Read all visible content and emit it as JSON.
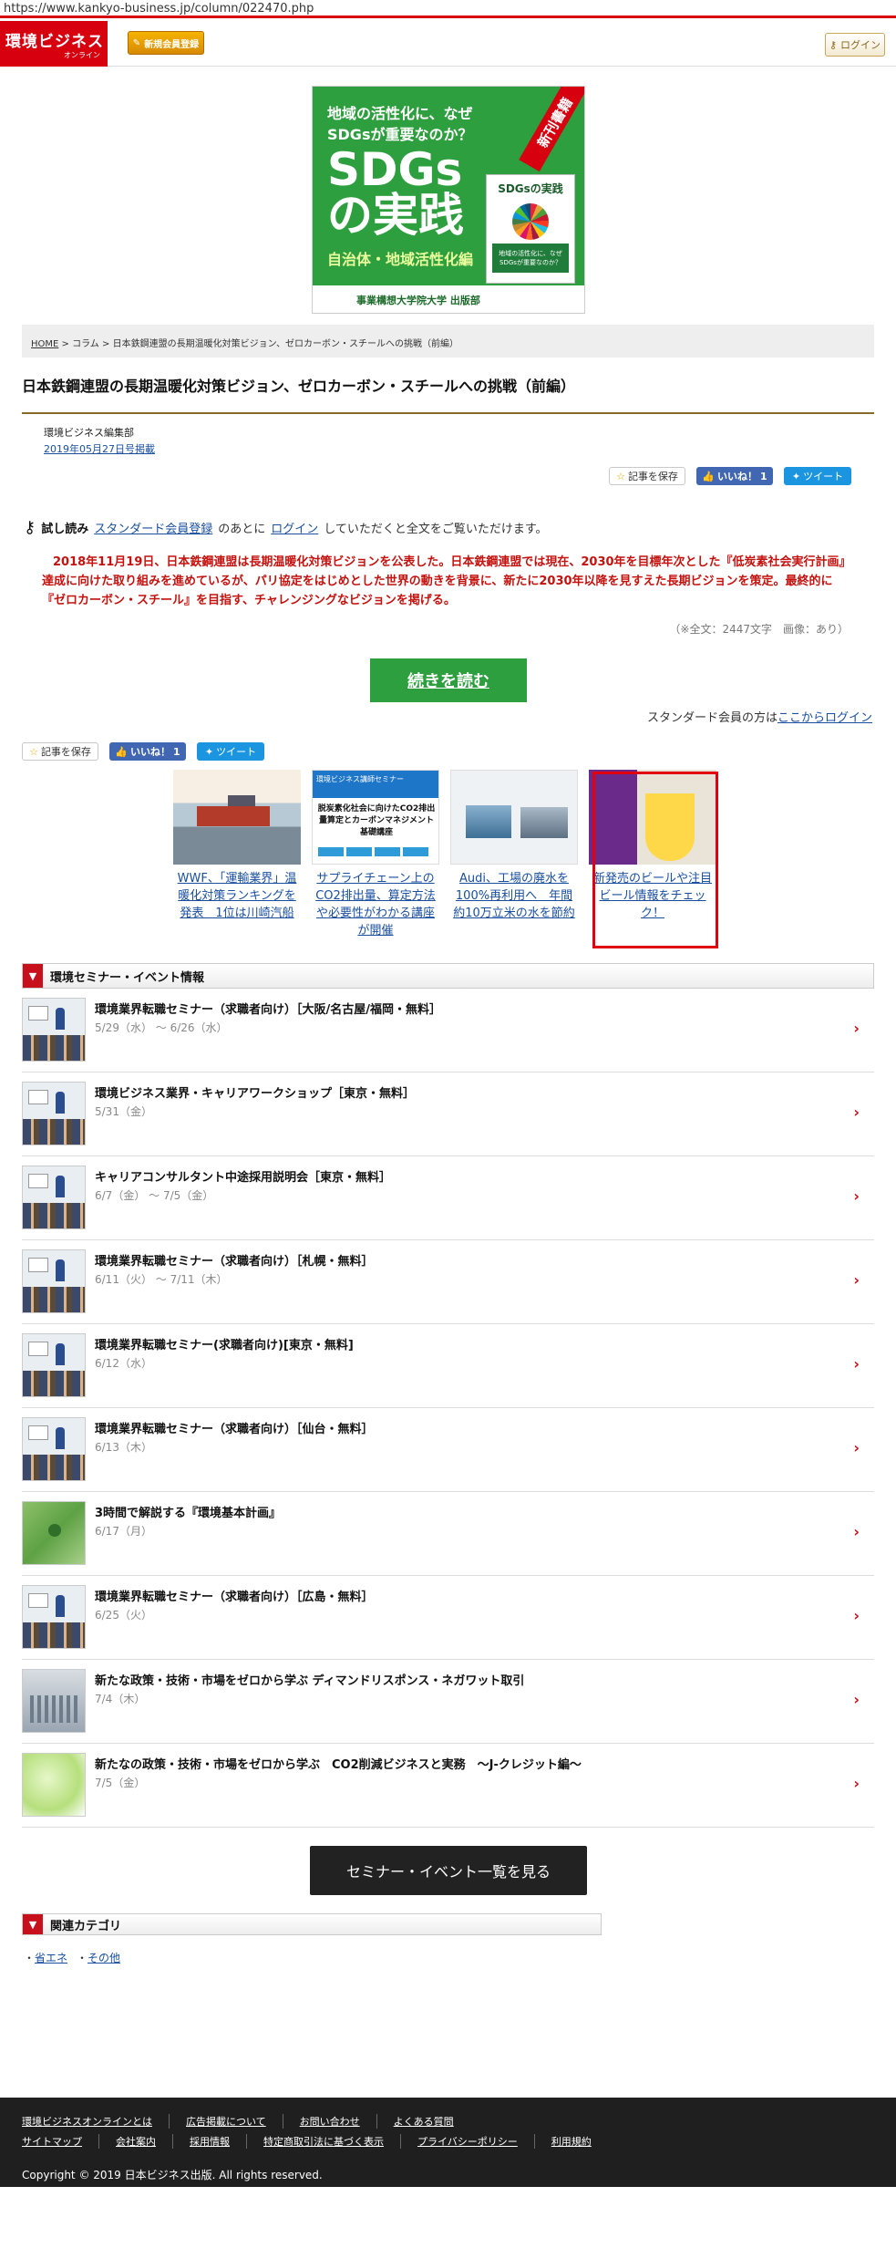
{
  "url": "https://www.kankyo-business.jp/column/022470.php",
  "header": {
    "logo_main": "環境ビジネス",
    "logo_sub": "オンライン",
    "register_label": "新規会員登録",
    "login_label": "ログイン"
  },
  "banner": {
    "question": "地域の活性化に、なぜSDGsが重要なのか？",
    "main_line1": "SDGs",
    "main_line2": "の実践",
    "subtitle": "自治体・地域活性化編",
    "publisher": "事業構想大学院大学 出版部",
    "ribbon": "新刊書籍",
    "book_title": "SDGsの実践",
    "book_band": "地域の活性化に、なぜSDGsが重要なのか？"
  },
  "breadcrumb": {
    "home": "HOME",
    "sep": ">",
    "column": "コラム",
    "current": "日本鉄鋼連盟の長期温暖化対策ビジョン、ゼロカーボン・スチールへの挑戦（前編）"
  },
  "article": {
    "title": "日本鉄鋼連盟の長期温暖化対策ビジョン、ゼロカーボン・スチールへの挑戦（前編）",
    "author": "環境ビジネス編集部",
    "date": "2019年05月27日号掲載",
    "trial_label": "試し読み",
    "trial_link": "スタンダード会員登録",
    "trial_mid": "のあとに",
    "trial_login": "ログイン",
    "trial_tail": "していただくと全文をご覧いただけます。",
    "lead": "2018年11月19日、日本鉄鋼連盟は長期温暖化対策ビジョンを公表した。日本鉄鋼連盟では現在、2030年を目標年次とした『低炭素社会実行計画』達成に向けた取り組みを進めているが、パリ協定をはじめとした世界の動きを背景に、新たに2030年以降を見すえた長期ビジョンを策定。最終的に『ゼロカーボン・スチール』を目指す、チャレンジングなビジョンを掲げる。",
    "wordcount": "（※全文：2447文字　画像：あり）",
    "more_label": "続きを読む",
    "std_text": "スタンダード会員の方は",
    "std_link": "ここからログイン"
  },
  "share": {
    "save": "記事を保存",
    "like": "いいね！",
    "like_count": "1",
    "tweet": "ツイート"
  },
  "cards": [
    {
      "caption": "WWF、「運輸業界」温暖化対策ランキングを発表　1位は川崎汽船"
    },
    {
      "caption": "サプライチェーン上のCO2排出量、算定方法や必要性がわかる講座が開催",
      "thumb_head": "環境ビジネス講師セミナー",
      "thumb_main": "脱炭素化社会に向けたCO2排出量算定とカーボンマネジメント基礎講座"
    },
    {
      "caption": "Audi、工場の廃水を100%再利用へ　年間約10万立米の水を節約"
    },
    {
      "caption": "新発売のビールや注目ビール情報をチェック！"
    }
  ],
  "events_section": {
    "title": "環境セミナー・イベント情報",
    "list_button": "セミナー・イベント一覧を見る",
    "items": [
      {
        "title": "環境業界転職セミナー（求職者向け）［大阪/名古屋/福岡・無料］",
        "date": "5/29（水） ～ 6/26（水）"
      },
      {
        "title": "環境ビジネス業界・キャリアワークショップ［東京・無料］",
        "date": "5/31（金）"
      },
      {
        "title": "キャリアコンサルタント中途採用説明会［東京・無料］",
        "date": "6/7（金） ～ 7/5（金）"
      },
      {
        "title": "環境業界転職セミナー（求職者向け）［札幌・無料］",
        "date": "6/11（火） ～ 7/11（木）"
      },
      {
        "title": "環境業界転職セミナー(求職者向け)[東京・無料]",
        "date": "6/12（水）"
      },
      {
        "title": "環境業界転職セミナー（求職者向け）［仙台・無料］",
        "date": "6/13（木）"
      },
      {
        "title": "3時間で解説する『環境基本計画』",
        "date": "6/17（月）"
      },
      {
        "title": "環境業界転職セミナー（求職者向け）［広島・無料］",
        "date": "6/25（火）"
      },
      {
        "title": "新たな政策・技術・市場をゼロから学ぶ ディマンドリスポンス・ネガワット取引",
        "date": "7/4（木）"
      },
      {
        "title": "新たなの政策・技術・市場をゼロから学ぶ　CO2削減ビジネスと実務　～J-クレジット編～",
        "date": "7/5（金）"
      }
    ]
  },
  "related": {
    "title": "関連カテゴリ",
    "links": [
      "省エネ",
      "その他"
    ]
  },
  "footer": {
    "row1": [
      "環境ビジネスオンラインとは",
      "広告掲載について",
      "お問い合わせ",
      "よくある質問"
    ],
    "row2": [
      "サイトマップ",
      "会社案内",
      "採用情報",
      "特定商取引法に基づく表示",
      "プライバシーポリシー",
      "利用規約"
    ],
    "copyright": "Copyright © 2019 日本ビジネス出版. All rights reserved."
  }
}
